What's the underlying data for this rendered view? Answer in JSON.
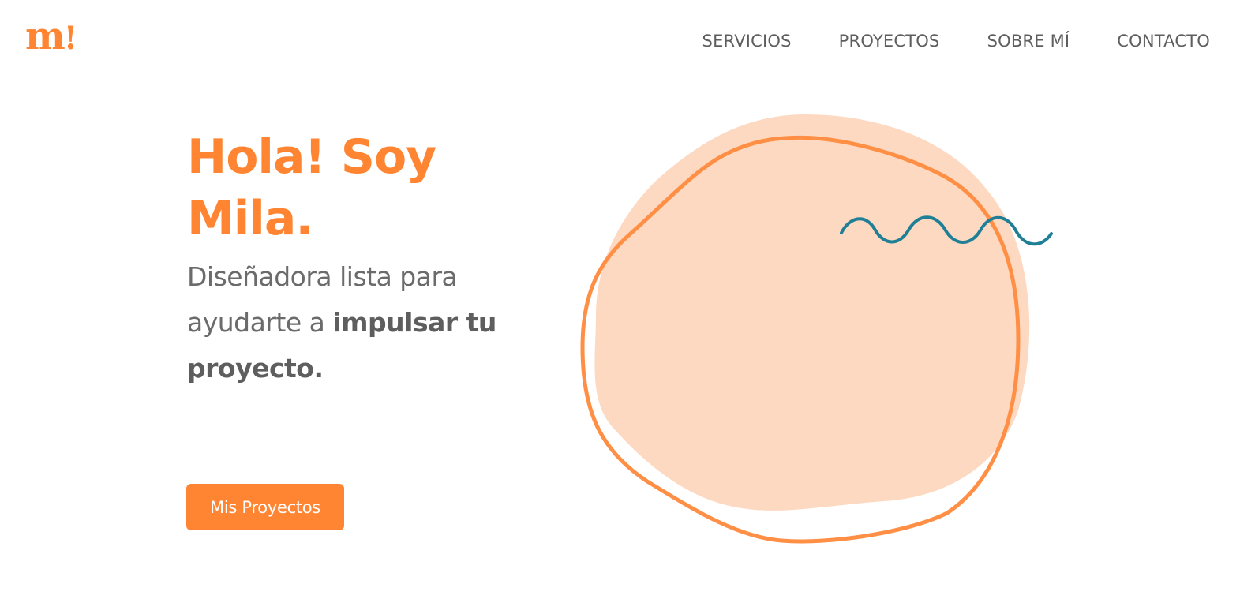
{
  "header": {
    "logo_text": "m",
    "logo_mark": "!",
    "nav": [
      {
        "label": "SERVICIOS"
      },
      {
        "label": "PROYECTOS"
      },
      {
        "label": "SOBRE MÍ"
      },
      {
        "label": "CONTACTO"
      }
    ]
  },
  "hero": {
    "title": "Hola! Soy Mila.",
    "subtitle_plain": "Diseñadora lista para ayudarte a ",
    "subtitle_bold": "impulsar tu proyecto.",
    "cta_label": "Mis Proyectos"
  },
  "colors": {
    "accent": "#ff8533",
    "blob_fill": "#fdd9c1",
    "wave": "#1e7f96",
    "text": "#6b6b6b"
  }
}
